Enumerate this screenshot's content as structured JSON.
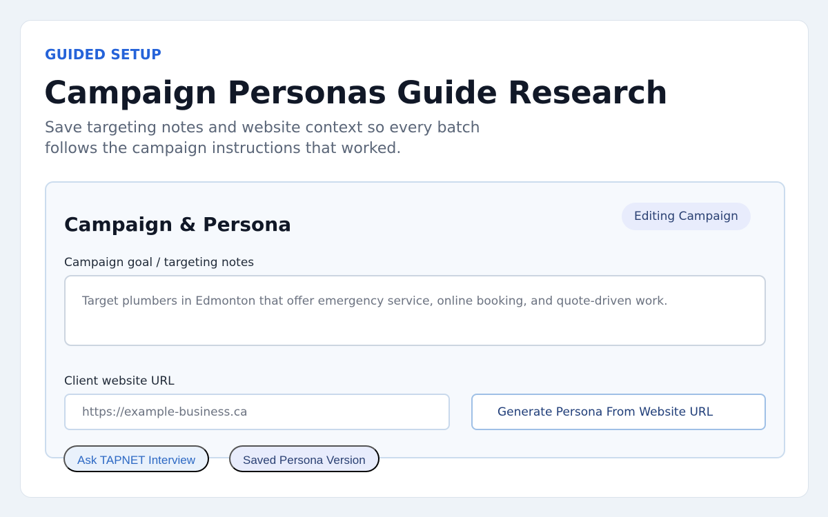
{
  "header": {
    "eyebrow": "GUIDED SETUP",
    "title": "Campaign Personas Guide Research",
    "subtitle": "Save targeting notes and website context so every batch follows the campaign instructions that worked."
  },
  "panel": {
    "title": "Campaign & Persona",
    "status_badge": "Editing Campaign",
    "goal_field": {
      "label": "Campaign goal / targeting notes",
      "value": "",
      "placeholder": "Target plumbers in Edmonton that offer emergency service, online booking, and quote-driven work."
    },
    "url_field": {
      "label": "Client website URL",
      "value": "",
      "placeholder": "https://example-business.ca"
    },
    "generate_button_label": "Generate Persona From Website URL"
  },
  "actions": {
    "ask_interview_label": "Ask TAPNET Interview",
    "saved_version_label": "Saved Persona Version"
  },
  "colors": {
    "accent": "#2563d9",
    "page_background": "#eef3f8",
    "panel_background": "#f6f9fd",
    "badge_background": "#e8ecfc"
  }
}
